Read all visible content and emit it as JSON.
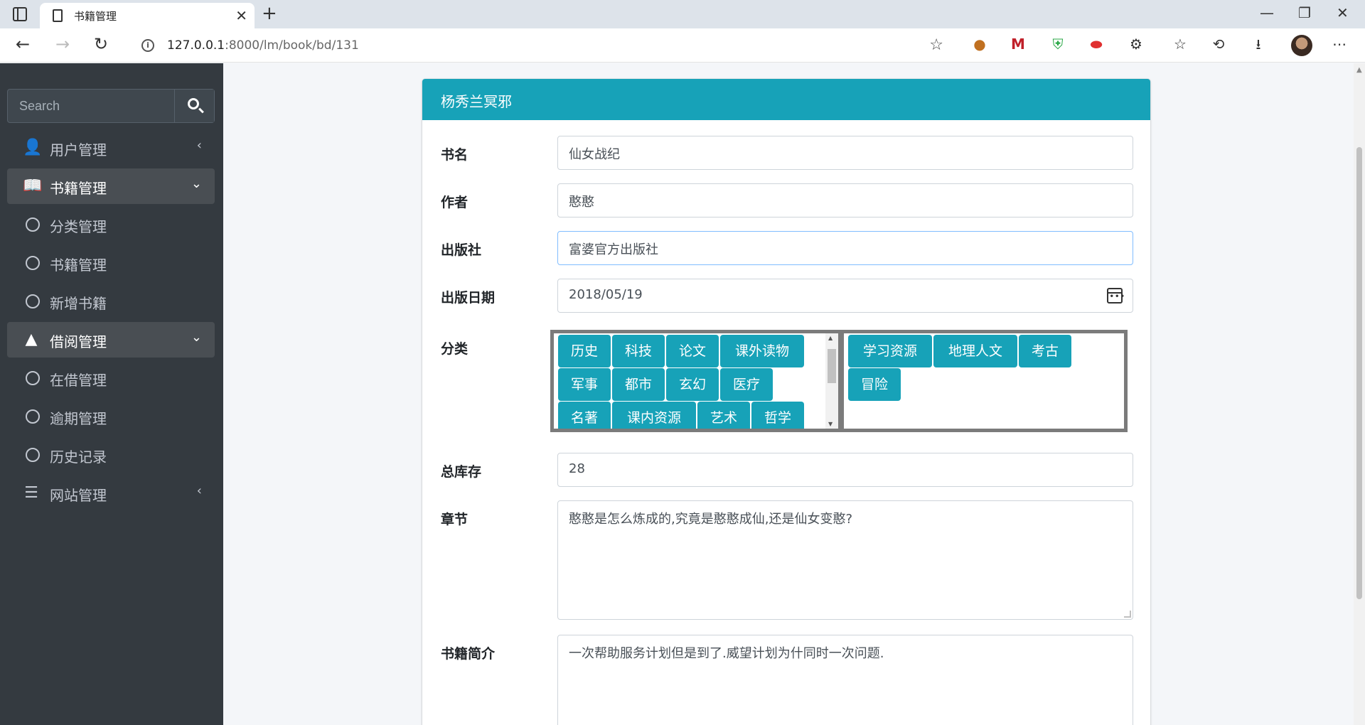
{
  "browser": {
    "tab_title": "书籍管理",
    "url_host": "127.0.0.1",
    "url_rest": ":8000/lm/book/bd/131"
  },
  "sidebar": {
    "search_placeholder": "Search",
    "items": [
      {
        "label": "用户管理",
        "icon": "user-icon",
        "arrow": "‹"
      },
      {
        "label": "书籍管理",
        "icon": "book-icon",
        "arrow": "⌄",
        "open": true
      },
      {
        "label": "分类管理",
        "icon": "circle-icon"
      },
      {
        "label": "书籍管理",
        "icon": "circle-icon"
      },
      {
        "label": "新增书籍",
        "icon": "circle-icon"
      },
      {
        "label": "借阅管理",
        "icon": "reader-icon",
        "arrow": "⌄",
        "open": true
      },
      {
        "label": "在借管理",
        "icon": "circle-icon"
      },
      {
        "label": "逾期管理",
        "icon": "circle-icon"
      },
      {
        "label": "历史记录",
        "icon": "circle-icon"
      },
      {
        "label": "网站管理",
        "icon": "bars-icon",
        "arrow": "‹"
      }
    ]
  },
  "card": {
    "title": "杨秀兰冥邪"
  },
  "form": {
    "name_label": "书名",
    "name_value": "仙女战纪",
    "author_label": "作者",
    "author_value": "憨憨",
    "publisher_label": "出版社",
    "publisher_value": "富婆官方出版社",
    "date_label": "出版日期",
    "date_value": "2018/05/19",
    "category_label": "分类",
    "category_available": [
      "历史",
      "科技",
      "论文",
      "课外读物",
      "军事",
      "都市",
      "玄幻",
      "医疗",
      "名著",
      "课内资源",
      "艺术",
      "哲学"
    ],
    "category_selected": [
      "学习资源",
      "地理人文",
      "考古",
      "冒险"
    ],
    "stock_label": "总库存",
    "stock_value": "28",
    "chapter_label": "章节",
    "chapter_value": "憨憨是怎么炼成的,究竟是憨憨成仙,还是仙女变憨?",
    "intro_label": "书籍简介",
    "intro_value": "一次帮助服务计划但是到了.威望计划为什同时一次问题."
  },
  "colors": {
    "accent": "#17a2b8",
    "sidebar_bg": "#343a40"
  }
}
